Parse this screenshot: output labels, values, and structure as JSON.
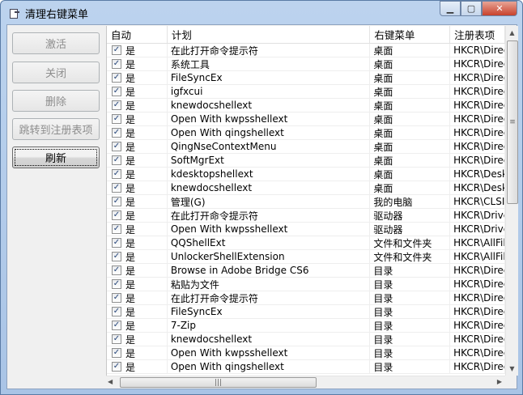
{
  "window": {
    "title": "清理右键菜单"
  },
  "buttons": [
    {
      "label": "激活",
      "enabled": false
    },
    {
      "label": "关闭",
      "enabled": false
    },
    {
      "label": "删除",
      "enabled": false
    },
    {
      "label": "跳转到注册表项",
      "enabled": false
    },
    {
      "label": "刷新",
      "enabled": true
    }
  ],
  "table": {
    "headers": [
      "自动",
      "计划",
      "右键菜单",
      "注册表项"
    ],
    "rows": [
      {
        "checked": true,
        "auto": "是",
        "name": "在此打开命令提示符",
        "menu": "桌面",
        "key": "HKCR\\Directo"
      },
      {
        "checked": true,
        "auto": "是",
        "name": "系统工具",
        "menu": "桌面",
        "key": "HKCR\\Directo"
      },
      {
        "checked": true,
        "auto": "是",
        "name": " FileSyncEx",
        "menu": "桌面",
        "key": "HKCR\\Directo"
      },
      {
        "checked": true,
        "auto": "是",
        "name": "igfxcui",
        "menu": "桌面",
        "key": "HKCR\\Directo"
      },
      {
        "checked": true,
        "auto": "是",
        "name": "knewdocshellext",
        "menu": "桌面",
        "key": "HKCR\\Directo"
      },
      {
        "checked": true,
        "auto": "是",
        "name": "Open With kwpsshellext",
        "menu": "桌面",
        "key": "HKCR\\Directo"
      },
      {
        "checked": true,
        "auto": "是",
        "name": "Open With qingshellext",
        "menu": "桌面",
        "key": "HKCR\\Directo"
      },
      {
        "checked": true,
        "auto": "是",
        "name": "QingNseContextMenu",
        "menu": "桌面",
        "key": "HKCR\\Directo"
      },
      {
        "checked": true,
        "auto": "是",
        "name": "SoftMgrExt",
        "menu": "桌面",
        "key": "HKCR\\Directo"
      },
      {
        "checked": true,
        "auto": "是",
        "name": "kdesktopshellext",
        "menu": "桌面",
        "key": "HKCR\\Deskto"
      },
      {
        "checked": true,
        "auto": "是",
        "name": "knewdocshellext",
        "menu": "桌面",
        "key": "HKCR\\Deskto"
      },
      {
        "checked": true,
        "auto": "是",
        "name": "管理(G)",
        "menu": "我的电脑",
        "key": "HKCR\\CLSID"
      },
      {
        "checked": true,
        "auto": "是",
        "name": "在此打开命令提示符",
        "menu": "驱动器",
        "key": "HKCR\\Drive\\"
      },
      {
        "checked": true,
        "auto": "是",
        "name": "Open With kwpsshellext",
        "menu": "驱动器",
        "key": "HKCR\\Drive\\"
      },
      {
        "checked": true,
        "auto": "是",
        "name": "QQShellExt",
        "menu": "文件和文件夹",
        "key": "HKCR\\AllFiles"
      },
      {
        "checked": true,
        "auto": "是",
        "name": "UnlockerShellExtension",
        "menu": "文件和文件夹",
        "key": "HKCR\\AllFiles"
      },
      {
        "checked": true,
        "auto": "是",
        "name": "Browse in Adobe Bridge CS6",
        "menu": "目录",
        "key": "HKCR\\Directo"
      },
      {
        "checked": true,
        "auto": "是",
        "name": "粘贴为文件",
        "menu": "目录",
        "key": "HKCR\\Directo"
      },
      {
        "checked": true,
        "auto": "是",
        "name": "在此打开命令提示符",
        "menu": "目录",
        "key": "HKCR\\Directo"
      },
      {
        "checked": true,
        "auto": "是",
        "name": " FileSyncEx",
        "menu": "目录",
        "key": "HKCR\\Directo"
      },
      {
        "checked": true,
        "auto": "是",
        "name": "7-Zip",
        "menu": "目录",
        "key": "HKCR\\Directo"
      },
      {
        "checked": true,
        "auto": "是",
        "name": "knewdocshellext",
        "menu": "目录",
        "key": "HKCR\\Directo"
      },
      {
        "checked": true,
        "auto": "是",
        "name": "Open With kwpsshellext",
        "menu": "目录",
        "key": "HKCR\\Directo"
      },
      {
        "checked": true,
        "auto": "是",
        "name": "Open With qingshellext",
        "menu": "目录",
        "key": "HKCR\\Directo"
      }
    ]
  },
  "icons": {
    "app": "cleanup-icon",
    "minimize": "minimize-icon",
    "maximize": "maximize-icon",
    "close": "close-icon"
  }
}
